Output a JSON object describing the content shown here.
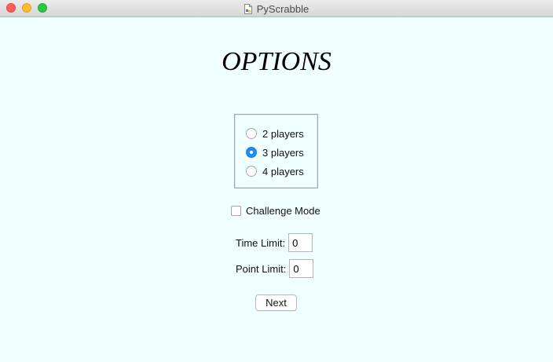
{
  "window": {
    "title": "PyScrabble"
  },
  "colors": {
    "background": "#f0ffff",
    "accent": "#1f8ef1"
  },
  "heading": "OPTIONS",
  "players": {
    "options": [
      {
        "label": "2 players",
        "checked": false
      },
      {
        "label": "3 players",
        "checked": true
      },
      {
        "label": "4 players",
        "checked": false
      }
    ]
  },
  "challenge": {
    "label": "Challenge Mode",
    "checked": false
  },
  "time_limit": {
    "label": "Time Limit:",
    "value": "0"
  },
  "point_limit": {
    "label": "Point Limit:",
    "value": "0"
  },
  "next_label": "Next",
  "icons": {
    "window_close": "close-icon",
    "window_minimize": "minimize-icon",
    "window_zoom": "zoom-icon",
    "document": "document-icon"
  }
}
